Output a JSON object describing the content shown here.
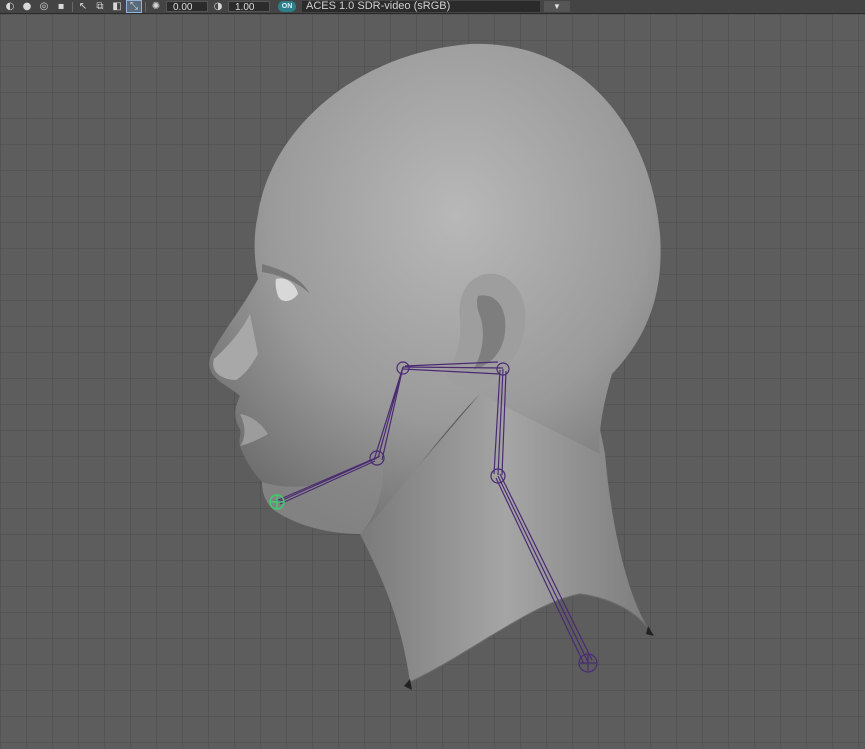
{
  "toolbar": {
    "icons": [
      "camera-icon",
      "shading-icon",
      "isolate-icon",
      "grid-toggle-icon",
      "select-tool-icon",
      "frame-icon",
      "overlay-icon",
      "xray-joints-icon",
      "exposure-icon",
      "gamma-icon"
    ],
    "exposure_value": "0.00",
    "gamma_value": "1.00",
    "colorspace_badge": "ON",
    "colorspace_label": "ACES 1.0 SDR-video (sRGB)",
    "dropdown_glyph": "▼"
  },
  "viewport": {
    "background_color": "#5d5d5d",
    "grid_color": "#4a4a4a",
    "mesh_color": "#9a9a9a",
    "joint_color": "#4a2a73",
    "selected_joint_color": "#39d26b"
  }
}
